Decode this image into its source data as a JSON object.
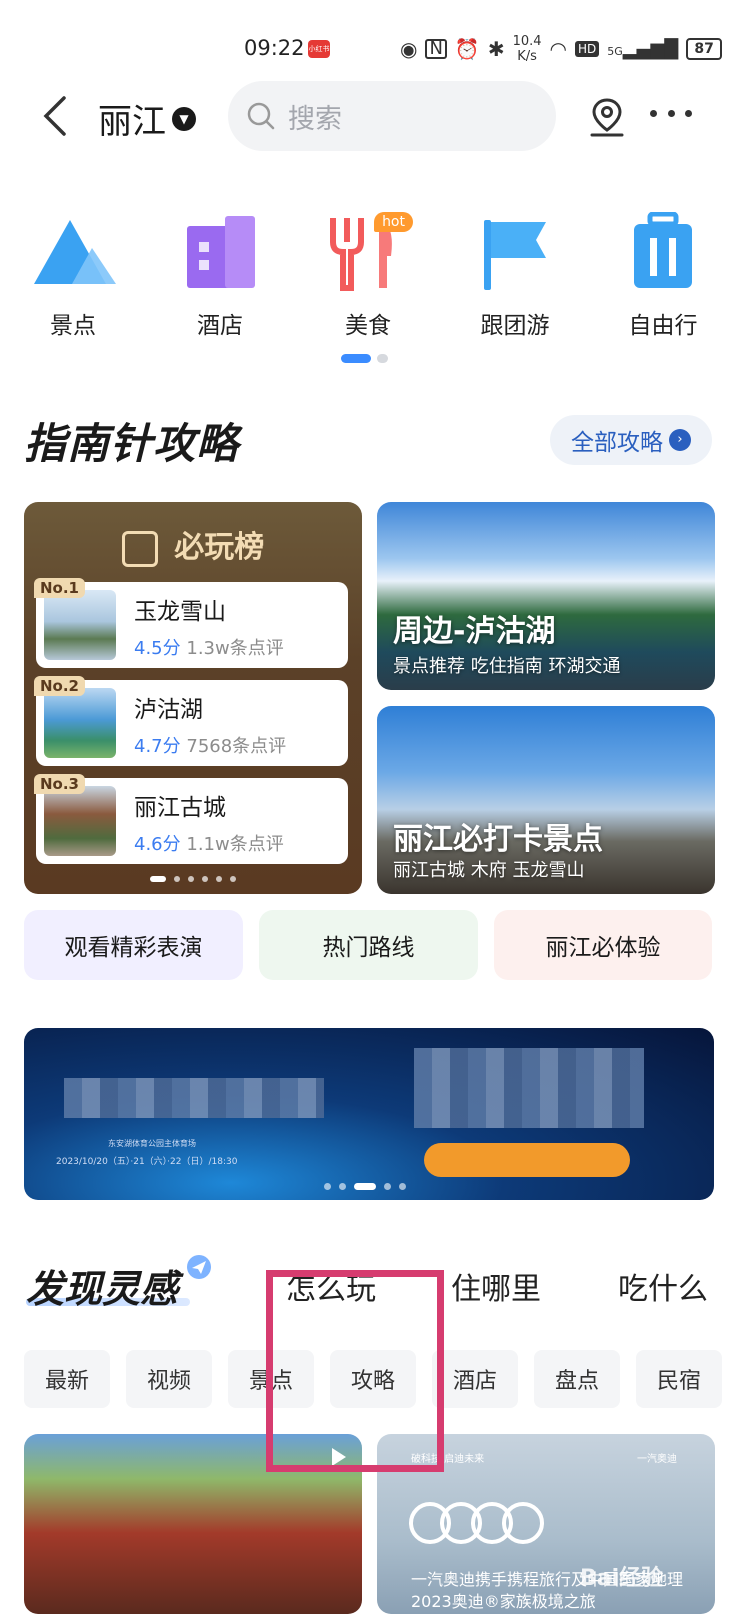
{
  "status_bar": {
    "time": "09:22",
    "badge": "小红书",
    "net_speed_value": "10.4",
    "net_speed_unit": "K/s",
    "hd": "HD",
    "signal": "5G",
    "battery": "87"
  },
  "header": {
    "city": "丽江",
    "search_placeholder": "搜索"
  },
  "categories": [
    {
      "label": "景点",
      "icon": "mountain-icon"
    },
    {
      "label": "酒店",
      "icon": "building-icon"
    },
    {
      "label": "美食",
      "icon": "fork-knife-icon",
      "badge": "hot"
    },
    {
      "label": "跟团游",
      "icon": "flag-icon"
    },
    {
      "label": "自由行",
      "icon": "luggage-icon"
    }
  ],
  "category_pager": {
    "pages": 2,
    "current": 1
  },
  "guide": {
    "title": "指南针攻略",
    "all_label": "全部攻略",
    "ranking": {
      "title": "必玩榜",
      "items": [
        {
          "no": "No.1",
          "name": "玉龙雪山",
          "score": "4.5分",
          "reviews": "1.3w条点评"
        },
        {
          "no": "No.2",
          "name": "泸沽湖",
          "score": "4.7分",
          "reviews": "7568条点评"
        },
        {
          "no": "No.3",
          "name": "丽江古城",
          "score": "4.6分",
          "reviews": "1.1w条点评"
        }
      ]
    },
    "cards": [
      {
        "title": "周边-泸沽湖",
        "subtitle": "景点推荐 吃住指南 环湖交通"
      },
      {
        "title": "丽江必打卡景点",
        "subtitle": "丽江古城 木府 玉龙雪山"
      }
    ],
    "chips": [
      "观看精彩表演",
      "热门路线",
      "丽江必体验"
    ]
  },
  "banner": {
    "location": "东安湖体育公园主体育场",
    "dates": "2023/10/20（五）·21（六）·22（日）/18:30",
    "dots": 5,
    "active_dot": 3
  },
  "discover": {
    "title": "发现灵感",
    "tabs": [
      "怎么玩",
      "住哪里",
      "吃什么"
    ],
    "tags": [
      "最新",
      "视频",
      "景点",
      "攻略",
      "酒店",
      "盘点",
      "民宿"
    ],
    "ad_card": {
      "top_left": "破科技 启迪未来",
      "top_right": "一汽奥迪",
      "line1": "一汽奥迪携手携程旅行及中国国家地理",
      "line2": "2023奥迪®家族极境之旅"
    }
  },
  "watermark": "Bai经验",
  "colors": {
    "accent": "#3b8cff",
    "highlight_box": "#d63c6f",
    "hot_badge": "#ff9a2e"
  }
}
